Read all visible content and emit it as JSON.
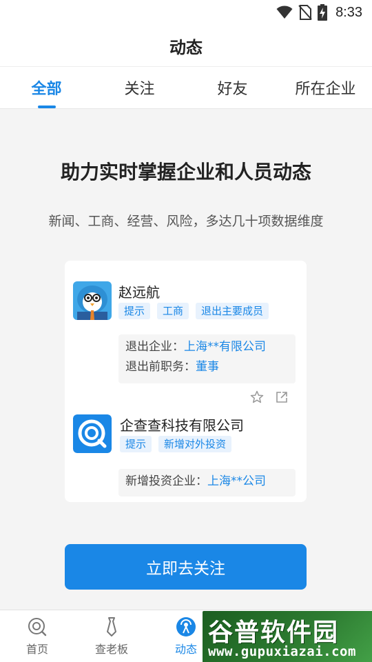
{
  "status_bar": {
    "time": "8:33"
  },
  "header": {
    "title": "动态"
  },
  "tabs": [
    {
      "label": "全部",
      "active": true
    },
    {
      "label": "关注",
      "active": false
    },
    {
      "label": "好友",
      "active": false
    },
    {
      "label": "所在企业",
      "active": false
    }
  ],
  "promo": {
    "headline": "助力实时掌握企业和人员动态",
    "subline": "新闻、工商、经营、风险，多达几十项数据维度"
  },
  "feed": [
    {
      "name": "赵远航",
      "avatar_icon": "person-cartoon-avatar",
      "tags": [
        "提示",
        "工商",
        "退出主要成员"
      ],
      "details": [
        {
          "label": "退出企业：",
          "value": "上海**有限公司"
        },
        {
          "label": "退出前职务：",
          "value": "董事"
        }
      ]
    },
    {
      "name": "企查查科技有限公司",
      "avatar_icon": "qcc-logo-icon",
      "tags": [
        "提示",
        "新增对外投资"
      ],
      "details": [
        {
          "label": "新增投资企业：",
          "value": "上海**公司"
        }
      ]
    }
  ],
  "follow_button": {
    "label": "立即去关注"
  },
  "bottom_nav": [
    {
      "label": "首页",
      "icon": "home-logo-icon",
      "active": false
    },
    {
      "label": "查老板",
      "icon": "tie-icon",
      "active": false
    },
    {
      "label": "动态",
      "icon": "broadcast-icon",
      "active": true
    }
  ],
  "watermark": {
    "title": "谷普软件园",
    "url": "www.gupuxiazai.com"
  },
  "colors": {
    "accent": "#1a87e6",
    "tag_bg": "#e8f2fd",
    "background": "#f4f4f4"
  }
}
